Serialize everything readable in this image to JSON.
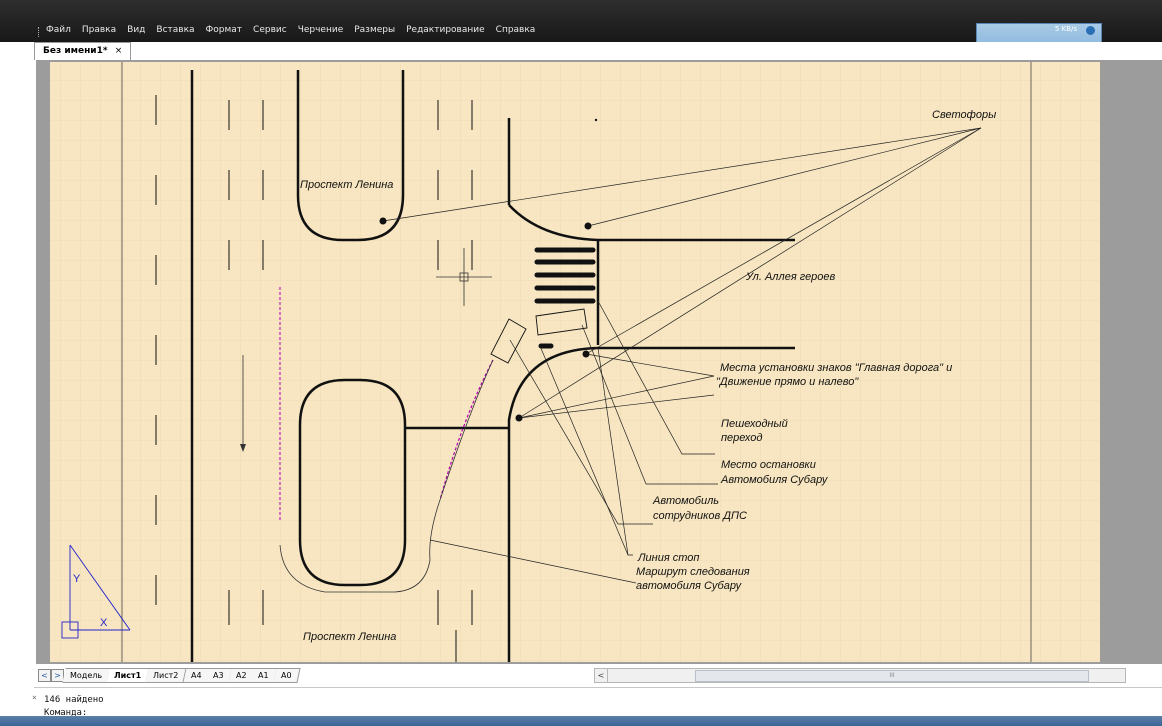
{
  "menu": [
    "Файл",
    "Правка",
    "Вид",
    "Вставка",
    "Формат",
    "Сервис",
    "Черчение",
    "Размеры",
    "Редактирование",
    "Справка"
  ],
  "net_widget": {
    "rate": "5 KB/s"
  },
  "document_tab": {
    "title": "Без имени1*",
    "close": "×"
  },
  "drawing_labels": {
    "svetofory": "Светофоры",
    "prospekt_top": "Проспект Ленина",
    "alleya": "Ул. Аллея героев",
    "mesta_1": "Места установки знаков \"Главная дорога\" и",
    "mesta_2": "\"Движение прямо и налево\"",
    "perekhod_1": "Пешеходный",
    "perekhod_2": "переход",
    "ostanovka_1": "Место остановки",
    "ostanovka_2": "Автомобиля Субару",
    "dps_1": "Автомобиль",
    "dps_2": "сотрудников ДПС",
    "liniya": "Линия стоп",
    "marshrut_1": "Маршрут следования",
    "marshrut_2": "автомобиля Субару",
    "prospekt_bottom": "Проспект Ленина",
    "ucs_y": "Y",
    "ucs_x": "X"
  },
  "sheet_nav": {
    "prev": "<",
    "next": ">"
  },
  "sheet_tabs": [
    "Модель",
    "Лист1",
    "Лист2",
    "A4",
    "A3",
    "A2",
    "A1",
    "A0"
  ],
  "active_sheet": "Лист1",
  "scroll": {
    "left_button": "<",
    "thumb_grip": "III"
  },
  "command_line": {
    "line1": "146 найдено",
    "line2": "Команда:",
    "gutter_close": "×",
    "gutter_pin": "◘"
  },
  "colors": {
    "paper": "#f7e6c1",
    "grid": "#e6d2ad",
    "ink": "#111111",
    "route": "#b400b4",
    "ucs": "#2222cc"
  }
}
